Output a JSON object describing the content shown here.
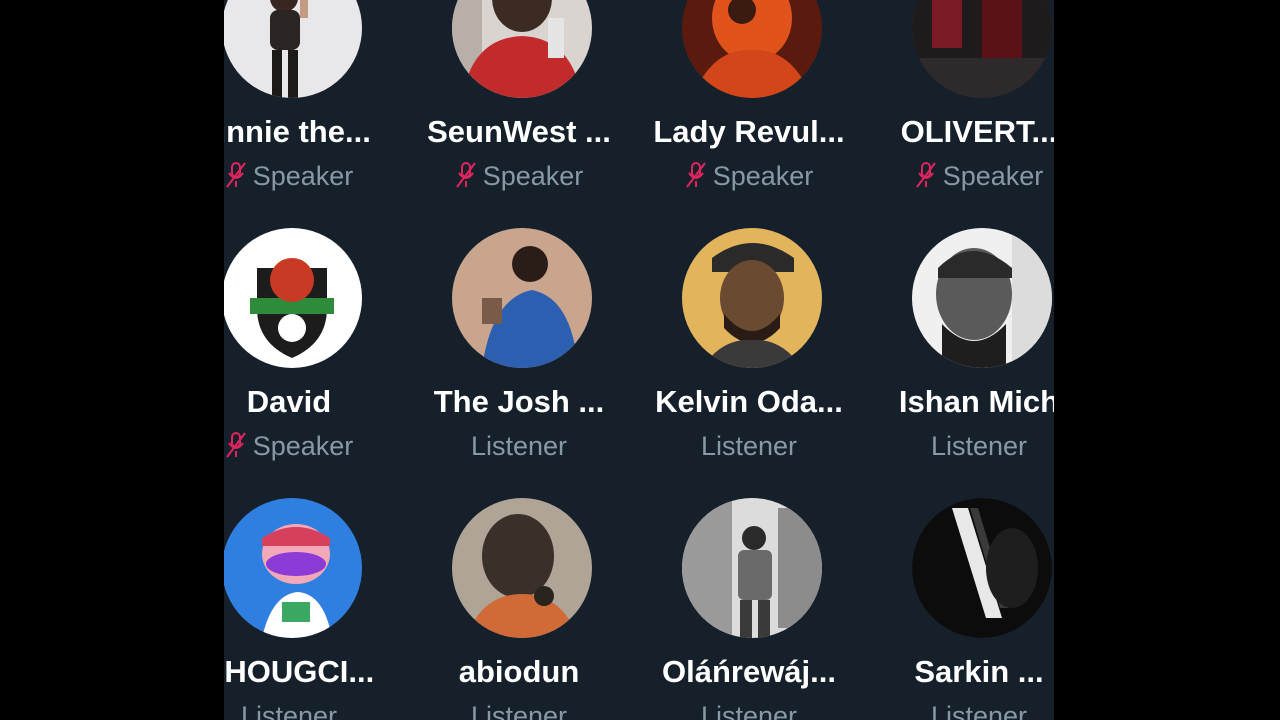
{
  "room": {
    "participants": [
      {
        "name": "unnie the...",
        "role": "Speaker",
        "muted": true,
        "avatar_icon": "woman-standing-photo"
      },
      {
        "name": "SeunWest ...",
        "role": "Speaker",
        "muted": true,
        "avatar_icon": "man-red-shirt-photo"
      },
      {
        "name": "Lady Revul...",
        "role": "Speaker",
        "muted": true,
        "avatar_icon": "orange-portrait-photo"
      },
      {
        "name": "OLIVERT...",
        "role": "Speaker",
        "muted": true,
        "avatar_icon": "dark-red-photo"
      },
      {
        "name": "David",
        "role": "Speaker",
        "muted": true,
        "avatar_icon": "sports-crest-logo"
      },
      {
        "name": "The Josh ...",
        "role": "Listener",
        "muted": false,
        "avatar_icon": "man-blue-suit-photo"
      },
      {
        "name": "Kelvin Oda...",
        "role": "Listener",
        "muted": false,
        "avatar_icon": "man-cap-beard-photo"
      },
      {
        "name": "Ishan Mich",
        "role": "Listener",
        "muted": false,
        "avatar_icon": "grayscale-portrait-photo"
      },
      {
        "name": "PHOUGCI...",
        "role": "Listener",
        "muted": false,
        "avatar_icon": "cartoon-character-avatar"
      },
      {
        "name": "abiodun",
        "role": "Listener",
        "muted": false,
        "avatar_icon": "blurred-selfie-photo"
      },
      {
        "name": "Oláńrewáj...",
        "role": "Listener",
        "muted": false,
        "avatar_icon": "man-outdoor-photo"
      },
      {
        "name": "Sarkin ...",
        "role": "Listener",
        "muted": false,
        "avatar_icon": "dark-figure-photo",
        "verified": true
      }
    ]
  },
  "colors": {
    "background": "#15202b",
    "letterbox": "#000000",
    "name_text": "#ffffff",
    "role_text": "#8899a6",
    "muted_mic": "#e0245e",
    "verified": "#4a9fe0"
  }
}
